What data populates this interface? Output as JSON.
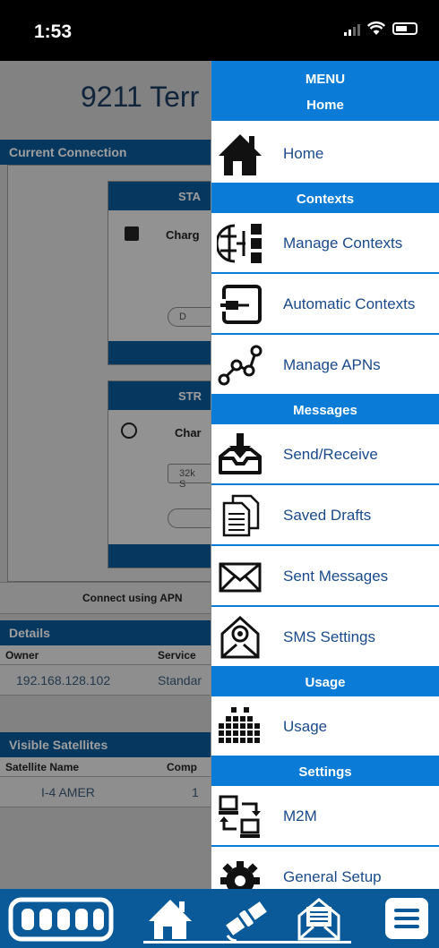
{
  "status_bar": {
    "time": "1:53"
  },
  "background": {
    "title": "9211 Terr",
    "current_connection_label": "Current Connection",
    "card1_head": "STA",
    "card1_text": "Charg",
    "card1_button": "D",
    "card2_head": "STR",
    "card2_text": "Char",
    "card2_speed": "32k S",
    "connect_label": "Connect using APN",
    "details_label": "Details",
    "details_columns": [
      "Owner",
      "Service"
    ],
    "details_row": [
      "192.168.128.102",
      "Standar"
    ],
    "satellites_label": "Visible Satellites",
    "satellites_columns": [
      "Satellite Name",
      "Comp"
    ],
    "satellites_row": [
      "I-4 AMER",
      "1"
    ]
  },
  "menu": {
    "title": "MENU",
    "home_section": "Home",
    "items": [
      {
        "label": "Home",
        "icon": "house-icon"
      },
      {
        "section": "Contexts"
      },
      {
        "label": "Manage Contexts",
        "icon": "contexts-icon"
      },
      {
        "label": "Automatic Contexts",
        "icon": "auto-context-icon"
      },
      {
        "label": "Manage APNs",
        "icon": "apn-nodes-icon"
      },
      {
        "section": "Messages"
      },
      {
        "label": "Send/Receive",
        "icon": "inbox-icon"
      },
      {
        "label": "Saved Drafts",
        "icon": "documents-icon"
      },
      {
        "label": "Sent Messages",
        "icon": "envelope-icon"
      },
      {
        "label": "SMS Settings",
        "icon": "sms-settings-icon"
      },
      {
        "section": "Usage"
      },
      {
        "label": "Usage",
        "icon": "usage-grid-icon"
      },
      {
        "section": "Settings"
      },
      {
        "label": "M2M",
        "icon": "m2m-icon"
      },
      {
        "label": "General Setup",
        "icon": "gear-icon"
      }
    ]
  },
  "tabbar": {
    "tabs": [
      "signal-strength-icon",
      "home-icon",
      "satellite-icon",
      "messages-icon",
      "menu-icon"
    ]
  },
  "colors": {
    "menu_blue": "#0a7bd6",
    "bar_blue": "#0a5a9a",
    "label_blue": "#1a4a8a"
  }
}
